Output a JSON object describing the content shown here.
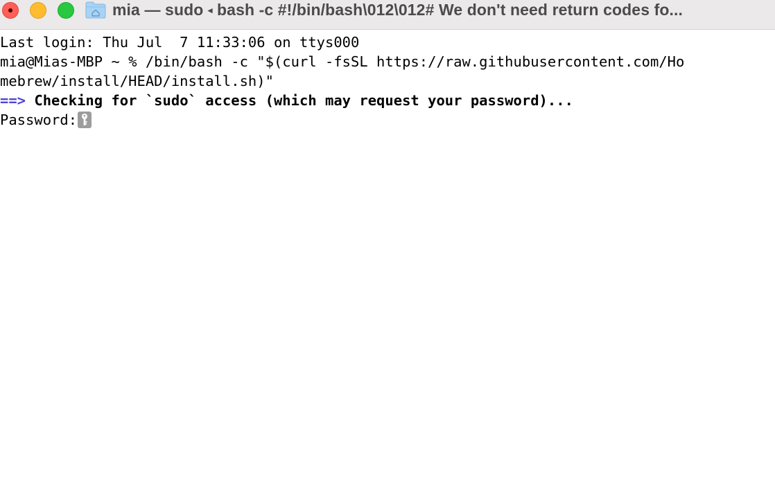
{
  "window": {
    "title_folder": "mia",
    "title_separator": "—",
    "title_process": "sudo",
    "title_arrow": "◂",
    "title_command": "bash -c #!/bin/bash\\012\\012# We don't need return codes fo...",
    "icon": "folder-home-icon",
    "traffic_lights": {
      "close_color": "#fe5f57",
      "minimize_color": "#febc2e",
      "zoom_color": "#28c840"
    }
  },
  "terminal": {
    "last_login": "Last login: Thu Jul  7 11:33:06 on ttys000",
    "command_line_1": "mia@Mias-MBP ~ % /bin/bash -c \"$(curl -fsSL https://raw.githubusercontent.com/Ho",
    "command_line_2": "mebrew/install/HEAD/install.sh)\"",
    "check_arrow": "==>",
    "check_message": " Checking for `sudo` access (which may request your password)...",
    "password_prompt": "Password:",
    "arrow_color": "#4e44d8",
    "cursor_icon": "key-icon"
  }
}
